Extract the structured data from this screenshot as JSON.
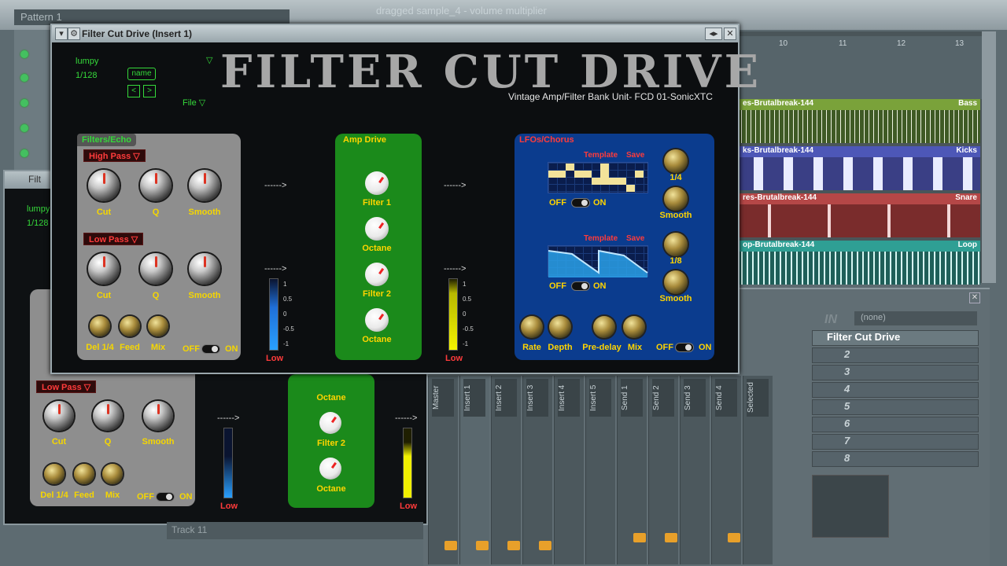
{
  "window": {
    "title": "Filter Cut Drive (Insert 1)"
  },
  "brand": {
    "title": "FILTER CUT DRIVE",
    "subtitle": "Vintage Amp/Filter Bank Unit- FCD 01-SonicXTC"
  },
  "preset": {
    "name": "lumpy",
    "rate": "1/128",
    "name_button": "name",
    "prev": "<",
    "next": ">",
    "file_menu": "File ▽"
  },
  "filters": {
    "title": "Filters/Echo",
    "high_pass_label": "High Pass",
    "low_pass_label": "Low Pass",
    "knob_labels": [
      "Cut",
      "Q",
      "Smooth"
    ],
    "echo_labels": [
      "Del 1/4",
      "Feed",
      "Mix"
    ],
    "off": "OFF",
    "on": "ON"
  },
  "amp": {
    "title": "Amp Drive",
    "labels": [
      "Filter 1",
      "Octane",
      "Filter 2",
      "Octane"
    ]
  },
  "arrows": {
    "a": "------>"
  },
  "meter": {
    "low": "Low",
    "scale": [
      "1",
      "0.5",
      "0",
      "-0.5",
      "-1"
    ]
  },
  "lfo": {
    "title": "LFOs/Chorus",
    "template": "Template",
    "save": "Save",
    "off": "OFF",
    "on": "ON",
    "rate1": "1/4",
    "smooth": "Smooth",
    "rate2": "1/8",
    "bottom_labels": [
      "Rate",
      "Depth",
      "Pre-delay",
      "Mix"
    ]
  },
  "back": {
    "pattern": "Pattern 1",
    "hint": "dragged sample_4 - volume multiplier",
    "track": "Track 11",
    "filter_title": "Filt",
    "lumpy": "lumpy",
    "rate": "1/128"
  },
  "playlist": {
    "ruler": [
      "10",
      "11",
      "12",
      "13"
    ],
    "tracks": [
      {
        "name": "es-Brutalbreak-144",
        "tag": "Bass"
      },
      {
        "name": "ks-Brutalbreak-144",
        "tag": "Kicks"
      },
      {
        "name": "res-Brutalbreak-144",
        "tag": "Snare"
      },
      {
        "name": "op-Brutalbreak-144",
        "tag": "Loop"
      }
    ]
  },
  "mixer": {
    "strips": [
      "Master",
      "Insert 1",
      "Insert 2",
      "Insert 3",
      "Insert 4",
      "Insert 5",
      "Send 1",
      "Send 2",
      "Send 3",
      "Send 4",
      "Selected"
    ],
    "in_label": "IN",
    "in_value": "(none)",
    "slot1": "Filter Cut Drive",
    "slots": [
      "2",
      "3",
      "4",
      "5",
      "6",
      "7",
      "8"
    ]
  }
}
